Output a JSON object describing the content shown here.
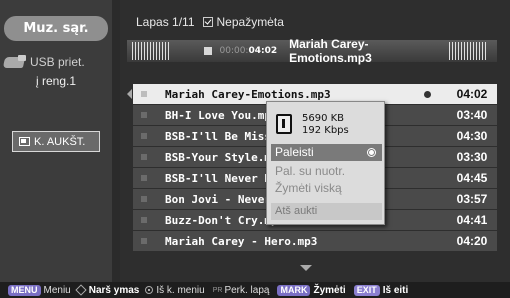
{
  "sidebar": {
    "title": "Muz. sąr.",
    "device_label": "USB priet.",
    "device_name": "į reng.1",
    "copy_button": "K. AUKŠT."
  },
  "header": {
    "page": "Lapas 1/11",
    "mark_label": "Nepažymėta"
  },
  "now_playing": {
    "time_dim": "00:00:",
    "time_bold": "04:02",
    "title": "Mariah Carey-Emotions.mp3"
  },
  "tracks": [
    {
      "name": "Mariah Carey-Emotions.mp3",
      "duration": "04:02"
    },
    {
      "name": "BH-I Love You.mp3",
      "duration": "03:40"
    },
    {
      "name": "BSB-I'll Be Missing You.mp3",
      "duration": "04:30"
    },
    {
      "name": "BSB-Your Style.mp3",
      "duration": "03:30"
    },
    {
      "name": "BSB-I'll Never Break.mp3",
      "duration": "04:45"
    },
    {
      "name": "Bon Jovi - Never Say.mp3",
      "duration": "03:57"
    },
    {
      "name": "Buzz-Don't Cry.mp3",
      "duration": "04:41"
    },
    {
      "name": "Mariah Carey - Hero.mp3",
      "duration": "04:20"
    }
  ],
  "popup": {
    "size": "5690 KB",
    "bitrate": "192 Kbps",
    "items": [
      "Paleisti",
      "Pal. su nuotr.",
      "Žymėti viską",
      "Atš aukti"
    ]
  },
  "footer": {
    "menu_key": "MENU",
    "menu_label": "Meniu",
    "nav_label": "Narš ymas",
    "ok_label": "Iš k. meniu",
    "pr_key": "PR",
    "page_label": "Perk. lapą",
    "mark_key": "MARK",
    "mark_label": "Žymėti",
    "exit_key": "EXIT",
    "exit_label": "Iš eiti"
  },
  "colors": {
    "selected_row": "#ececec",
    "row": "#4a4a4a",
    "key_accent": "#7a6fc4"
  }
}
